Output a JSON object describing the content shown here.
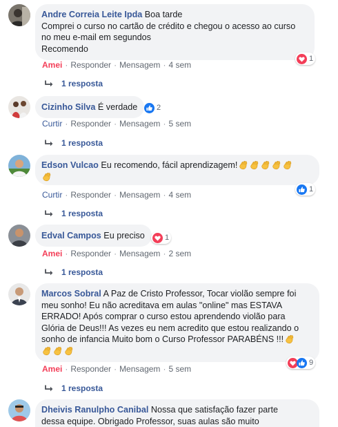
{
  "comments": [
    {
      "author": "Andre Correia Leite Ipda",
      "text": "Boa tarde",
      "text2": "Comprei o curso no cartão de crédito e chegou o acesso ao curso",
      "text3": "no meu e-mail em segundos",
      "text4": "Recomendo",
      "action_like": "Amei",
      "action_reply": "Responder",
      "action_message": "Mensagem",
      "time": "4 sem",
      "reaction_count": "1",
      "replies": "1 resposta"
    },
    {
      "author": "Cizinho Silva",
      "text": "É verdade",
      "action_like": "Curtir",
      "action_reply": "Responder",
      "action_message": "Mensagem",
      "time": "5 sem",
      "reaction_count": "2",
      "replies": "1 resposta"
    },
    {
      "author": "Edson Vulcao",
      "text": "Eu recomendo, fácil aprendizagem!",
      "action_like": "Curtir",
      "action_reply": "Responder",
      "action_message": "Mensagem",
      "time": "4 sem",
      "reaction_count": "1",
      "replies": "1 resposta"
    },
    {
      "author": "Edval Campos",
      "text": "Eu preciso",
      "action_like": "Amei",
      "action_reply": "Responder",
      "action_message": "Mensagem",
      "time": "2 sem",
      "reaction_count": "1",
      "replies": "1 resposta"
    },
    {
      "author": "Marcos Sobral",
      "text": "A Paz de Cristo Professor, Tocar violão sempre foi",
      "text2": "meu sonho! Eu não acreditava em aulas \"online\" mas ESTAVA",
      "text3": "ERRADO! Após comprar o curso estou aprendendo violão para",
      "text4": "Glória de Deus!!! As vezes eu nem acredito que estou realizando o",
      "text5": "sonho de infancia Muito bom o Curso Professor PARABÉNS !!!",
      "action_like": "Amei",
      "action_reply": "Responder",
      "action_message": "Mensagem",
      "time": "5 sem",
      "reaction_count": "9",
      "replies": "1 resposta"
    },
    {
      "author": "Dheivis Ranulpho Canibal",
      "text": "Nossa que satisfação fazer parte",
      "text2": "dessa equipe. Obrigado Professor, suas aulas são muito"
    }
  ],
  "colors": {
    "link": "#385898",
    "love": "#f33e58",
    "like": "#1877f2",
    "bubble": "#f2f3f5",
    "meta": "#606770"
  },
  "icons": {
    "love": "heart-reaction-icon",
    "like": "thumbs-up-reaction-icon",
    "clap": "clapping-hands-emoji",
    "reply_arrow": "reply-arrow-icon"
  }
}
